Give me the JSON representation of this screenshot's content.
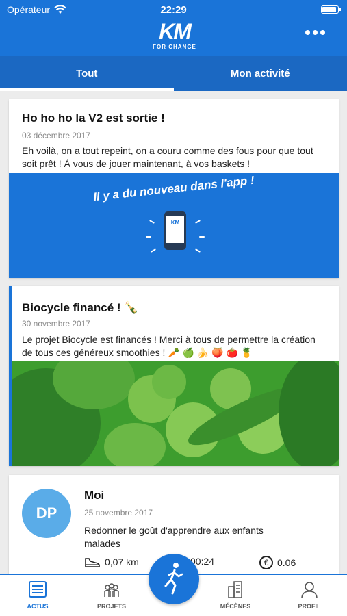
{
  "status": {
    "carrier": "Opérateur",
    "time": "22:29"
  },
  "header": {
    "logo_big": "KM",
    "logo_small": "FOR CHANGE"
  },
  "tabs": [
    {
      "label": "Tout"
    },
    {
      "label": "Mon activité"
    }
  ],
  "feed": [
    {
      "title": "Ho ho ho la V2 est sortie !",
      "date": "03 décembre 2017",
      "body": "Eh voilà, on a tout repeint, on a couru comme des fous pour que tout soit prêt ! À vous de jouer maintenant, à vos baskets !",
      "banner_text": "Il y a du nouveau dans l'app !",
      "banner_phone_logo": "KM"
    },
    {
      "title": "Biocycle financé ! 🍾",
      "date": "30 novembre 2017",
      "body": "Le projet Biocycle est financés ! Merci à tous de permettre la création de tous ces généreux smoothies ! 🥕 🍏 🍌 🍑 🍅 🍍"
    },
    {
      "initials": "DP",
      "title": "Moi",
      "date": "25 novembre 2017",
      "body": "Redonner le goût d'apprendre aux enfants malades",
      "distance": "0,07 km",
      "duration": "00:24",
      "amount": "0.06",
      "currency_symbol": "€"
    }
  ],
  "tabbar": [
    {
      "label": "ACTUS",
      "icon": "news-list-icon"
    },
    {
      "label": "PROJETS",
      "icon": "people-icon"
    },
    {
      "label": "MÉCÈNES",
      "icon": "buildings-icon"
    },
    {
      "label": "PROFIL",
      "icon": "user-icon"
    }
  ],
  "fab": {
    "icon": "runner-icon"
  },
  "colors": {
    "brand": "#1a74d8",
    "avatar": "#5aace8",
    "photo_green": "#3d9d2e"
  }
}
